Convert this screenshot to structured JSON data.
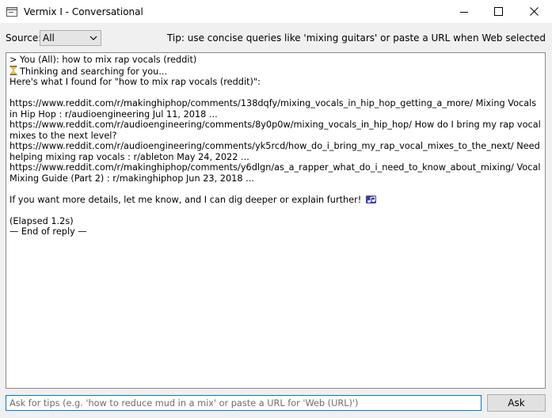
{
  "window": {
    "title": "Vermix I - Conversational",
    "controls": {
      "minimize": "minimize",
      "maximize": "maximize",
      "close": "close"
    }
  },
  "toolbar": {
    "source_label": "Source:",
    "source_selected": "All",
    "tip": "Tip: use concise queries like 'mixing guitars' or paste a URL when Web selected"
  },
  "conversation": {
    "lines": [
      "> You (All): how to mix rap vocals (reddit)",
      "Thinking and searching for you...",
      "Here's what I found for \"how to mix rap vocals (reddit)\":",
      "",
      "https://www.reddit.com/r/makinghiphop/comments/138dqfy/mixing_vocals_in_hip_hop_getting_a_more/ Mixing Vocals in Hip Hop : r/audioengineering Jul 11, 2018 ... https://www.reddit.com/r/audioengineering/comments/8y0p0w/mixing_vocals_in_hip_hop/ How do I bring my rap vocal mixes to the next level? https://www.reddit.com/r/audioengineering/comments/yk5rcd/how_do_i_bring_my_rap_vocal_mixes_to_the_next/ Need helping mixing rap vocals : r/ableton May 24, 2022 ... https://www.reddit.com/r/makinghiphop/comments/y6dlgn/as_a_rapper_what_do_i_need_to_know_about_mixing/ Vocal Mixing Guide (Part 2) : r/makinghiphop Jun 23, 2018 ...",
      "",
      "If you want more details, let me know, and I can dig deeper or explain further!",
      "",
      "(Elapsed 1.2s)",
      "— End of reply —"
    ]
  },
  "input": {
    "placeholder": "Ask for tips (e.g. 'how to reduce mud in a mix' or paste a URL for 'Web (URL)')",
    "value": ""
  },
  "ask_button": {
    "label": "Ask"
  },
  "colors": {
    "accent": "#0078d7",
    "border": "#828790"
  }
}
